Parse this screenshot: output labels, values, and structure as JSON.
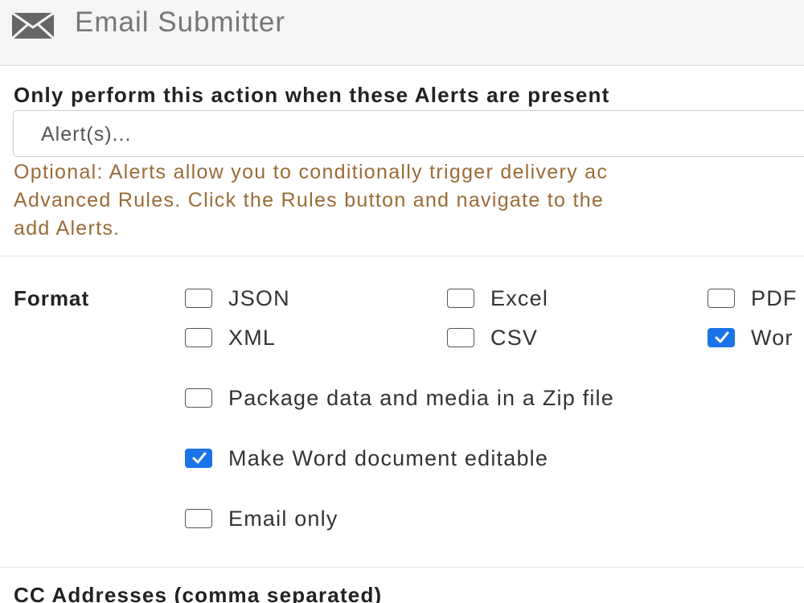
{
  "header": {
    "icon": "envelope-icon",
    "title": "Email Submitter"
  },
  "alerts": {
    "label": "Only perform this action when these Alerts are present",
    "placeholder": "Alert(s)...",
    "help_lines": [
      "Optional: Alerts allow you to conditionally trigger delivery ac",
      "Advanced Rules. Click the Rules button and navigate to the",
      "add Alerts."
    ]
  },
  "format": {
    "label": "Format",
    "options": [
      {
        "label": "JSON",
        "checked": false
      },
      {
        "label": "Excel",
        "checked": false
      },
      {
        "label": "PDF",
        "checked": false
      },
      {
        "label": "XML",
        "checked": false
      },
      {
        "label": "CSV",
        "checked": false
      },
      {
        "label": "Wor",
        "checked": true
      }
    ],
    "extra_options": [
      {
        "label": "Package data and media in a Zip file",
        "checked": false
      },
      {
        "label": "Make Word document editable",
        "checked": true
      },
      {
        "label": "Email only",
        "checked": false
      }
    ]
  },
  "cc": {
    "label": "CC Addresses (comma separated)"
  },
  "colors": {
    "accent": "#1a73e8",
    "help_text": "#9a6b35",
    "header_bg": "#f5f5f5"
  }
}
